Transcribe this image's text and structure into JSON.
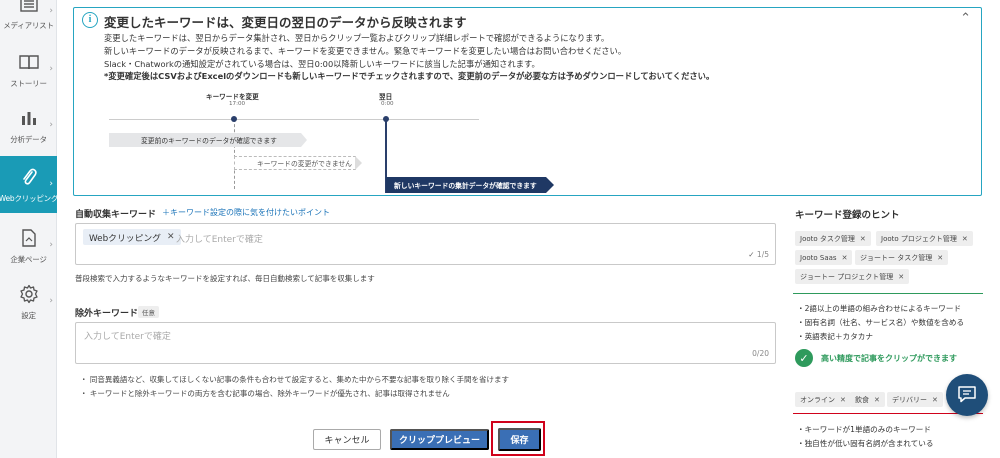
{
  "sidebar": {
    "items": [
      {
        "label": "メディアリスト",
        "icon": "list-icon"
      },
      {
        "label": "ストーリー",
        "icon": "book-icon"
      },
      {
        "label": "分析データ",
        "icon": "bar-chart-icon"
      },
      {
        "label": "Webクリッピング",
        "icon": "paperclip-icon",
        "active": true
      },
      {
        "label": "企業ページ",
        "icon": "document-icon"
      },
      {
        "label": "設定",
        "icon": "gear-icon"
      }
    ]
  },
  "notice": {
    "title": "変更したキーワードは、変更日の翌日のデータから反映されます",
    "lines": [
      "変更したキーワードは、翌日からデータ集計され、翌日からクリップ一覧およびクリップ詳細レポートで確認ができるようになります。",
      "新しいキーワードのデータが反映されるまで、キーワードを変更できません。緊急でキーワードを変更したい場合はお問い合わせください。",
      "Slack・Chatworkの通知設定がされている場合は、翌日0:00以降新しいキーワードに該当した記事が通知されます。"
    ],
    "bold_line": "*変更確定後はCSVおよびExcelのダウンロードも新しいキーワードでチェックされますので、変更前のデータが必要な方は予めダウンロードしておいてください。",
    "timeline": {
      "change_label": "キーワードを変更",
      "change_time": "17:00",
      "next_label": "翌日",
      "next_time": "0:00",
      "before_data": "変更前のキーワードのデータが確認できます",
      "cannot_change": "キーワードの変更ができません",
      "new_data": "新しいキーワードの集計データが確認できます"
    }
  },
  "auto_keyword": {
    "label": "自動収集キーワード",
    "hint_link": "＋キーワード設定の際に気を付けたいポイント",
    "tags": [
      "Webクリッピング"
    ],
    "placeholder": "入力してEnterで確定",
    "counter": "1/5",
    "help": "普段検索で入力するようなキーワードを設定すれば、毎日自動検索して記事を収集します"
  },
  "exclude_keyword": {
    "label": "除外キーワード",
    "badge": "任意",
    "placeholder": "入力してEnterで確定",
    "counter": "0/20",
    "notes": [
      "同音異義語など、収集してほしくない記事の条件も合わせて設定すると、集めた中から不要な記事を取り除く手間を省けます",
      "キーワードと除外キーワードの両方を含む記事の場合、除外キーワードが優先され、記事は取得されません"
    ]
  },
  "buttons": {
    "cancel": "キャンセル",
    "preview": "クリッププレビュー",
    "save": "保存"
  },
  "hints": {
    "title": "キーワード登録のヒント",
    "good_chips": [
      "Jooto タスク管理",
      "Jooto プロジェクト管理",
      "Jooto Saas",
      "ジョートー タスク管理",
      "ジョートー プロジェクト管理"
    ],
    "good_points": [
      "・2語以上の単語の組み合わせによるキーワード",
      "・固有名詞（社名、サービス名）や数値を含める",
      "・英語表記＋カタカナ"
    ],
    "good_result": "高い精度で記事をクリップができます",
    "bad_chips": [
      "オンライン",
      "飲食",
      "デリバリー"
    ],
    "bad_points": [
      "・キーワードが1単語のみのキーワード",
      "・独自性が低い固有名詞が含まれている"
    ],
    "colors": {
      "good": "#2e9a5c",
      "bad": "#d0021b",
      "accent": "#1a9bb6"
    }
  }
}
